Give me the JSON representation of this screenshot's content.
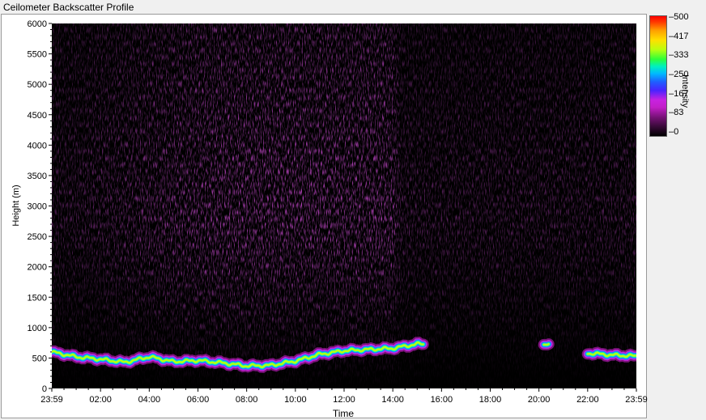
{
  "window": {
    "title": "Ceilometer Backscatter Profile"
  },
  "colorbar": {
    "label": "Intensity",
    "ticks": [
      "500",
      "417",
      "333",
      "250",
      "167",
      "83",
      "0"
    ]
  },
  "chart_data": {
    "type": "heatmap",
    "title": "Ceilometer Backscatter Profile",
    "xlabel": "Time",
    "ylabel": "Height (m)",
    "xticks": [
      "23:59",
      "02:00",
      "04:00",
      "06:00",
      "08:00",
      "10:00",
      "12:00",
      "14:00",
      "16:00",
      "18:00",
      "20:00",
      "22:00",
      "23:59"
    ],
    "yticks": [
      "0",
      "500",
      "1000",
      "1500",
      "2000",
      "2500",
      "3000",
      "3500",
      "4000",
      "4500",
      "5000",
      "5500",
      "6000"
    ],
    "ylim": [
      0,
      6000
    ],
    "color_range": [
      0,
      500
    ],
    "colormap": "black-magenta-blue-cyan-green-yellow-red",
    "layer_height_m": {
      "hours": [
        0,
        1,
        2,
        3,
        4,
        5,
        6,
        7,
        8,
        9,
        10,
        11,
        12,
        13,
        14,
        15,
        20.3,
        22,
        23,
        24
      ],
      "values": [
        600,
        520,
        480,
        430,
        520,
        440,
        460,
        420,
        370,
        380,
        450,
        560,
        620,
        640,
        660,
        730,
        720,
        580,
        550,
        530
      ]
    },
    "layer_gaps_hours": [
      [
        15.3,
        20.2
      ],
      [
        20.45,
        22.0
      ]
    ],
    "upper_noise": {
      "note": "scattered magenta backscatter, strongest between 07:00 and 14:00 around 2000-4500 m",
      "peak_intensity": 200
    }
  }
}
